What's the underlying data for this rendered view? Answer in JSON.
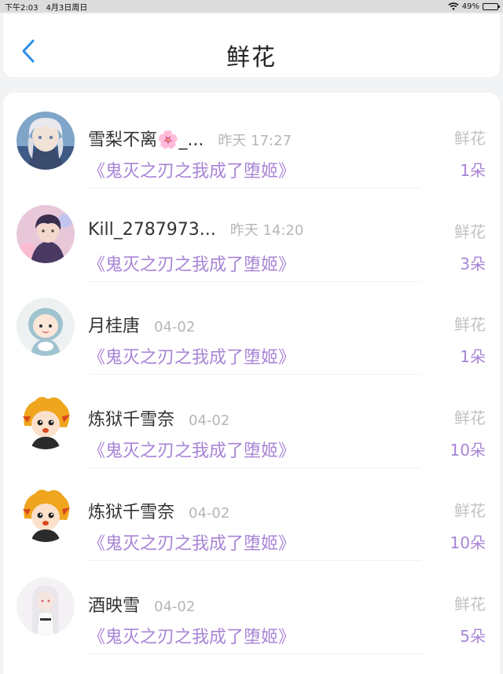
{
  "status": {
    "time": "下午2:03",
    "date": "4月3日周日",
    "battery": "49%",
    "battery_level": 0.49
  },
  "header": {
    "title": "鲜花"
  },
  "rows": [
    {
      "name": "雪梨不离🌸_...",
      "time": "昨天 17:27",
      "book": "《鬼灭之刃之我成了堕姬》",
      "gift": "鲜花",
      "count": "1朵",
      "avatar": "avatar-white-hair"
    },
    {
      "name": "Kill_2787973...",
      "time": "昨天 14:20",
      "book": "《鬼灭之刃之我成了堕姬》",
      "gift": "鲜花",
      "count": "3朵",
      "avatar": "avatar-anime-boy"
    },
    {
      "name": "月桂唐",
      "time": "04-02",
      "book": "《鬼灭之刃之我成了堕姬》",
      "gift": "鲜花",
      "count": "1朵",
      "avatar": "avatar-chibi-hood"
    },
    {
      "name": "炼狱千雪奈",
      "time": "04-02",
      "book": "《鬼灭之刃之我成了堕姬》",
      "gift": "鲜花",
      "count": "10朵",
      "avatar": "avatar-flame-chibi"
    },
    {
      "name": "炼狱千雪奈",
      "time": "04-02",
      "book": "《鬼灭之刃之我成了堕姬》",
      "gift": "鲜花",
      "count": "10朵",
      "avatar": "avatar-flame-chibi"
    },
    {
      "name": "酒映雪",
      "time": "04-02",
      "book": "《鬼灭之刃之我成了堕姬》",
      "gift": "鲜花",
      "count": "5朵",
      "avatar": "avatar-white-girl"
    }
  ]
}
